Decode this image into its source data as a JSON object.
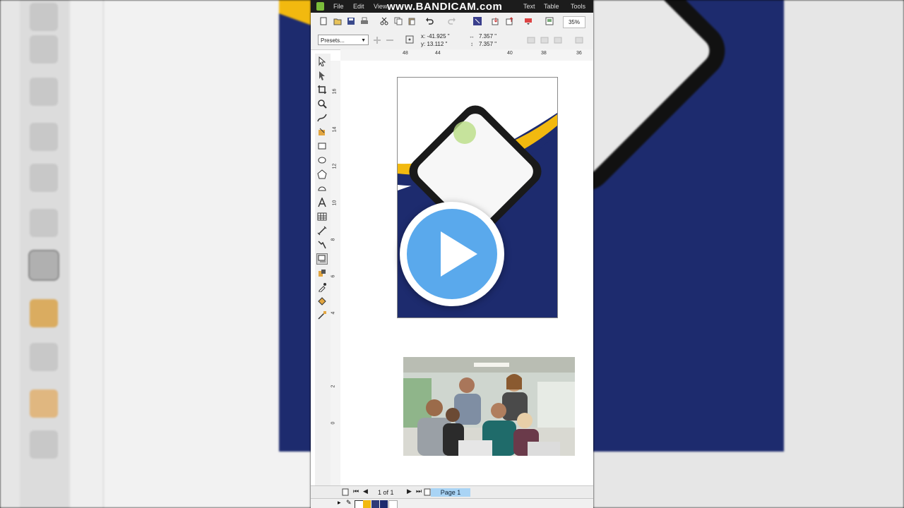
{
  "menu": {
    "items": [
      "File",
      "Edit",
      "View",
      "Text",
      "Table",
      "Tools"
    ],
    "watermark": "www.BANDICAM.com"
  },
  "toolbar": {
    "zoom": "35%"
  },
  "property_bar": {
    "presets": "Presets...",
    "x": "x: -41.925 \"",
    "y": "y: 13.112 \"",
    "width": "7.357 \"",
    "height": "7.357 \""
  },
  "rulers": {
    "horizontal": [
      "48",
      "44",
      "40",
      "38",
      "36"
    ],
    "vertical": [
      "16",
      "14",
      "12",
      "10",
      "8",
      "6",
      "4",
      "2",
      "0"
    ]
  },
  "status": {
    "page_count": "1 of 1",
    "page_tab": "Page 1"
  },
  "colors": {
    "navy": "#1d2b6e",
    "yellow": "#f2b90f",
    "dark": "#1a1a1a",
    "accent_green": "#b9dd84",
    "play_blue": "#5aa9ec"
  }
}
